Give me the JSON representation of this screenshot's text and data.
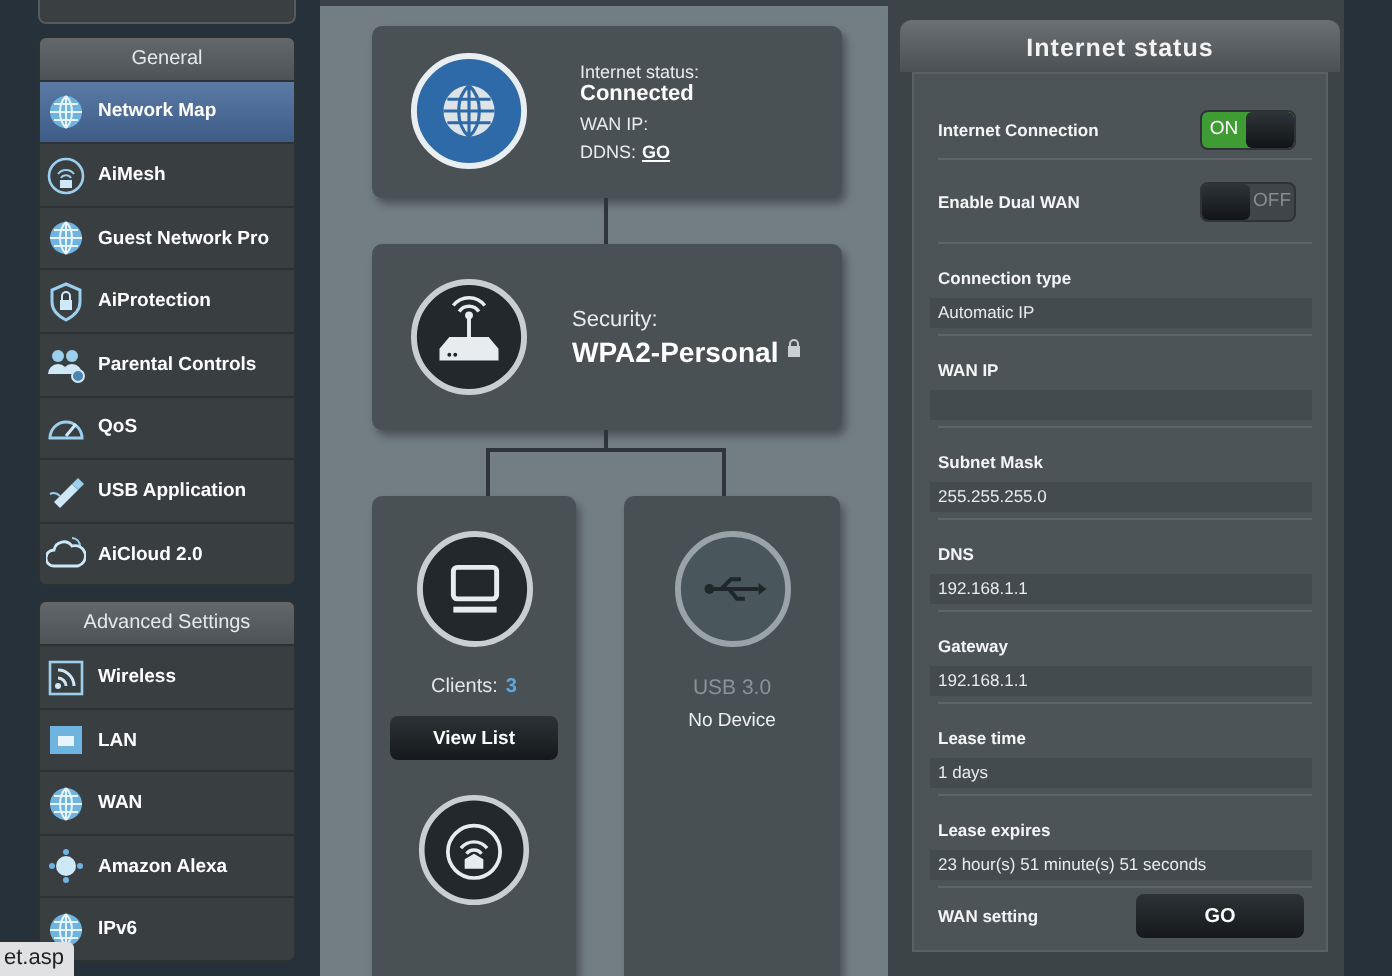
{
  "sidebar": {
    "sections": [
      {
        "title": "General",
        "items": [
          {
            "label": "Network Map",
            "selected": true
          },
          {
            "label": "AiMesh",
            "selected": false
          },
          {
            "label": "Guest Network Pro",
            "selected": false
          },
          {
            "label": "AiProtection",
            "selected": false
          },
          {
            "label": "Parental Controls",
            "selected": false
          },
          {
            "label": "QoS",
            "selected": false
          },
          {
            "label": "USB Application",
            "selected": false
          },
          {
            "label": "AiCloud 2.0",
            "selected": false
          }
        ]
      },
      {
        "title": "Advanced Settings",
        "items": [
          {
            "label": "Wireless",
            "selected": false
          },
          {
            "label": "LAN",
            "selected": false
          },
          {
            "label": "WAN",
            "selected": false
          },
          {
            "label": "Amazon Alexa",
            "selected": false
          },
          {
            "label": "IPv6",
            "selected": false
          }
        ]
      }
    ]
  },
  "network_map": {
    "internet": {
      "status_label": "Internet status:",
      "status": "Connected",
      "wan_ip_label": "WAN IP:",
      "ddns_label": "DDNS:",
      "ddns_link": "GO"
    },
    "router": {
      "security_label": "Security:",
      "security": "WPA2-Personal"
    },
    "clients": {
      "label": "Clients:",
      "count": "3",
      "button": "View List"
    },
    "usb": {
      "title": "USB 3.0",
      "status": "No Device",
      "disabled": true
    }
  },
  "status_panel": {
    "title": "Internet status",
    "rows": [
      {
        "kind": "toggle",
        "label": "Internet Connection",
        "on": true,
        "text": "ON"
      },
      {
        "kind": "toggle",
        "label": "Enable Dual WAN",
        "on": false,
        "text": "OFF"
      },
      {
        "kind": "field",
        "label": "Connection type",
        "value": "Automatic IP"
      },
      {
        "kind": "field",
        "label": "WAN IP"
      },
      {
        "kind": "field",
        "label": "Subnet Mask",
        "value": "255.255.255.0"
      },
      {
        "kind": "field",
        "label": "DNS",
        "value": "192.168.1.1"
      },
      {
        "kind": "field",
        "label": "Gateway",
        "value": "192.168.1.1"
      },
      {
        "kind": "field",
        "label": "Lease time",
        "value": "1 days"
      },
      {
        "kind": "field",
        "label": "Lease expires",
        "value": "23 hour(s) 51 minute(s) 51 seconds"
      },
      {
        "kind": "button",
        "label": "WAN setting",
        "button": "GO"
      }
    ]
  },
  "status_url": "et.asp"
}
